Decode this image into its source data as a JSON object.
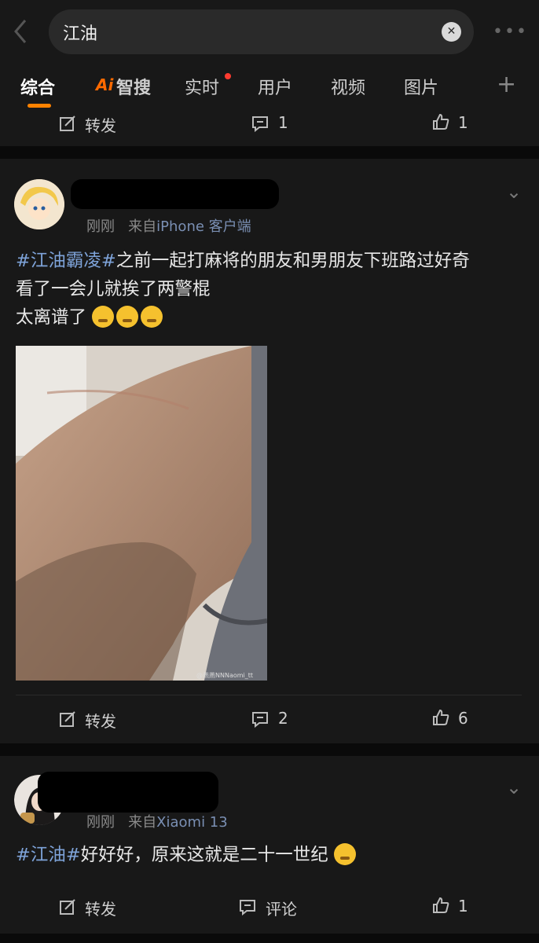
{
  "search": {
    "query": "江油"
  },
  "tabs": [
    "综合",
    "Ai",
    "智搜",
    "实时",
    "用户",
    "视频",
    "图片"
  ],
  "post0": {
    "repost": "转发",
    "comments": "1",
    "likes": "1"
  },
  "post1": {
    "time": "刚刚",
    "source_prefix": "来自",
    "source": "iPhone 客户端",
    "hashtag": "#江油霸凌#",
    "line1": "之前一起打麻将的朋友和男朋友下班路过好奇",
    "line2": "看了一会儿就挨了两警棍",
    "line3": "太离谱了",
    "watermark": "@燕燕NNNaomi_tt",
    "repost": "转发",
    "comments": "2",
    "likes": "6"
  },
  "post2": {
    "time": "刚刚",
    "source_prefix": "来自",
    "source": "Xiaomi 13",
    "hashtag": "#江油#",
    "text": "好好好，原来这就是二十一世纪",
    "repost": "转发",
    "comment": "评论",
    "likes": "1"
  },
  "icons": [
    "back-icon",
    "clear-icon",
    "more-icon",
    "add-tab-icon",
    "repost-icon",
    "comment-icon",
    "like-icon",
    "chevron-down-icon"
  ]
}
